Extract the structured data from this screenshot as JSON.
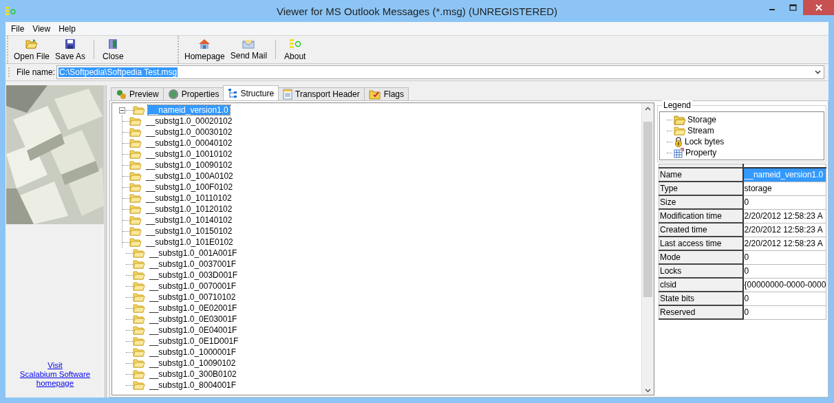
{
  "window": {
    "title": "Viewer for MS Outlook Messages (*.msg) (UNREGISTERED)"
  },
  "menu": [
    "File",
    "View",
    "Help"
  ],
  "toolbar": {
    "groups": [
      {
        "sections": [
          [
            {
              "label": "Open File",
              "kind": "open"
            },
            {
              "label": "Save As",
              "kind": "save"
            }
          ],
          [
            {
              "label": "Close",
              "kind": "close"
            }
          ]
        ]
      },
      {
        "sections": [
          [
            {
              "label": "Homepage",
              "kind": "home"
            },
            {
              "label": "Send Mail",
              "kind": "mail"
            }
          ],
          [
            {
              "label": "About",
              "kind": "about"
            }
          ]
        ]
      }
    ]
  },
  "file_name": {
    "label": "File name:",
    "value": "C:\\Softpedia\\Softpedia Test.msg",
    "text_selected": true
  },
  "sidebar": {
    "link_lines": [
      "Visit",
      "Scalabium Software",
      "homepage"
    ]
  },
  "tabs": [
    {
      "label": "Preview",
      "kind": "preview",
      "selected": false
    },
    {
      "label": "Properties",
      "kind": "properties",
      "selected": false
    },
    {
      "label": "Structure",
      "kind": "structure",
      "selected": true
    },
    {
      "label": "Transport Header",
      "kind": "header",
      "selected": false
    },
    {
      "label": "Flags",
      "kind": "flags",
      "selected": false
    }
  ],
  "tree": [
    {
      "label": "__nameid_version1.0",
      "selected": true,
      "expanded": true,
      "children": [
        {
          "label": "__substg1.0_00020102",
          "selected": false
        },
        {
          "label": "__substg1.0_00030102",
          "selected": false
        },
        {
          "label": "__substg1.0_00040102",
          "selected": false
        },
        {
          "label": "__substg1.0_10010102",
          "selected": false
        },
        {
          "label": "__substg1.0_10090102",
          "selected": false
        },
        {
          "label": "__substg1.0_100A0102",
          "selected": false
        },
        {
          "label": "__substg1.0_100F0102",
          "selected": false
        },
        {
          "label": "__substg1.0_10110102",
          "selected": false
        },
        {
          "label": "__substg1.0_10120102",
          "selected": false
        },
        {
          "label": "__substg1.0_10140102",
          "selected": false
        },
        {
          "label": "__substg1.0_10150102",
          "selected": false
        },
        {
          "label": "__substg1.0_101E0102",
          "selected": false
        }
      ]
    },
    {
      "label": "__substg1.0_001A001F",
      "selected": false
    },
    {
      "label": "__substg1.0_0037001F",
      "selected": false
    },
    {
      "label": "__substg1.0_003D001F",
      "selected": false
    },
    {
      "label": "__substg1.0_0070001F",
      "selected": false
    },
    {
      "label": "__substg1.0_00710102",
      "selected": false
    },
    {
      "label": "__substg1.0_0E02001F",
      "selected": false
    },
    {
      "label": "__substg1.0_0E03001F",
      "selected": false
    },
    {
      "label": "__substg1.0_0E04001F",
      "selected": false
    },
    {
      "label": "__substg1.0_0E1D001F",
      "selected": false
    },
    {
      "label": "__substg1.0_1000001F",
      "selected": false
    },
    {
      "label": "__substg1.0_10090102",
      "selected": false
    },
    {
      "label": "__substg1.0_300B0102",
      "selected": false
    },
    {
      "label": "__substg1.0_8004001F",
      "selected": false
    }
  ],
  "legend": {
    "title": "Legend",
    "items": [
      {
        "label": "Storage",
        "kind": "storage"
      },
      {
        "label": "Stream",
        "kind": "stream"
      },
      {
        "label": "Lock bytes",
        "kind": "lock"
      },
      {
        "label": "Property",
        "kind": "property"
      }
    ]
  },
  "properties": [
    {
      "name": "Name",
      "value": "__nameid_version1.0",
      "selected": true
    },
    {
      "name": "Type",
      "value": "storage",
      "selected": false
    },
    {
      "name": "Size",
      "value": "0",
      "selected": false
    },
    {
      "name": "Modification time",
      "value": "2/20/2012 12:58:23 A",
      "selected": false
    },
    {
      "name": "Created time",
      "value": "2/20/2012 12:58:23 A",
      "selected": false
    },
    {
      "name": "Last access time",
      "value": "2/20/2012 12:58:23 A",
      "selected": false
    },
    {
      "name": "Mode",
      "value": "0",
      "selected": false
    },
    {
      "name": "Locks",
      "value": "0",
      "selected": false
    },
    {
      "name": "clsid",
      "value": "{00000000-0000-0000",
      "selected": false
    },
    {
      "name": "State bits",
      "value": "0",
      "selected": false
    },
    {
      "name": "Reserved",
      "value": "0",
      "selected": false
    }
  ]
}
